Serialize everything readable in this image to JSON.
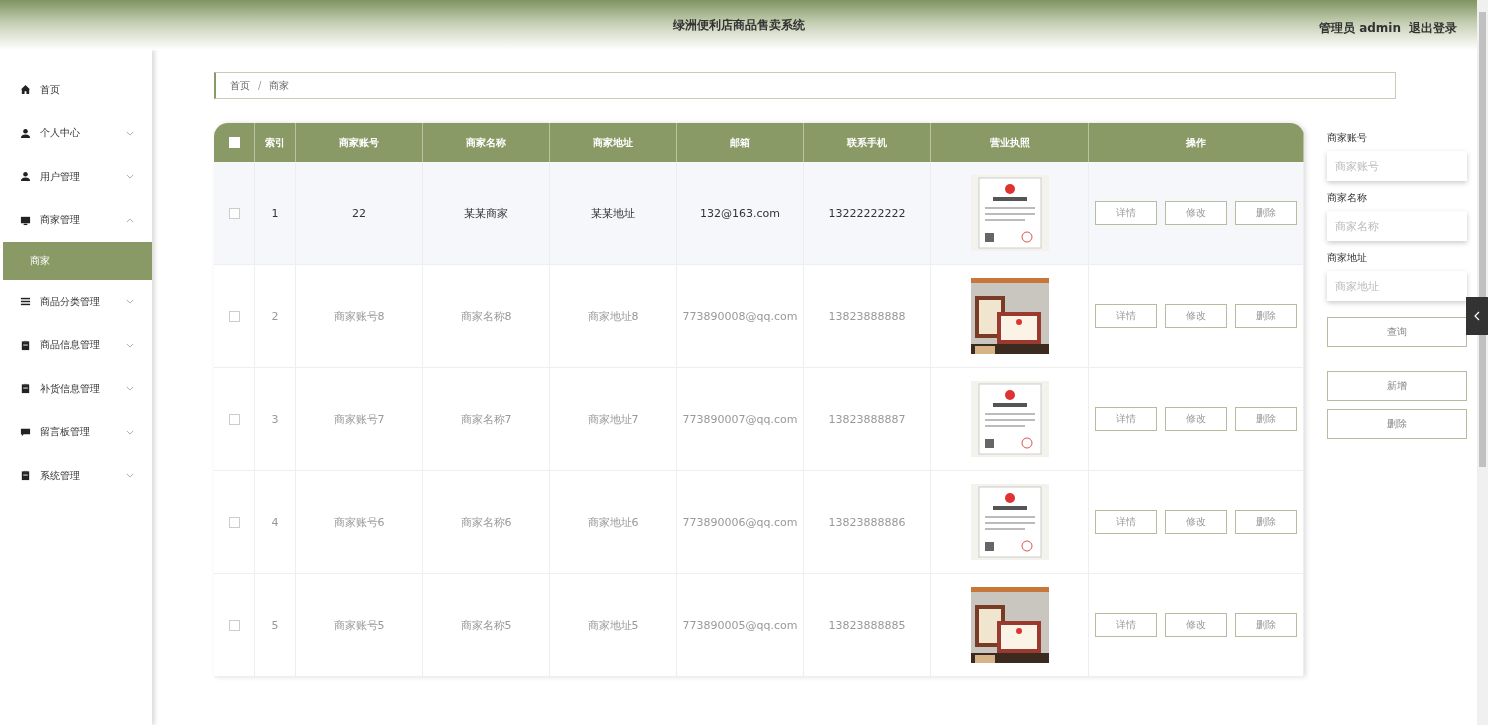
{
  "header": {
    "title": "绿洲便利店商品售卖系统",
    "user": "管理员 admin",
    "logout": "退出登录"
  },
  "sidebar": {
    "items": [
      {
        "label": "首页"
      },
      {
        "label": "个人中心",
        "expanded": false
      },
      {
        "label": "用户管理",
        "expanded": false
      },
      {
        "label": "商家管理",
        "expanded": true,
        "children": [
          {
            "label": "商家",
            "selected": true
          }
        ]
      },
      {
        "label": "商品分类管理",
        "expanded": false
      },
      {
        "label": "商品信息管理",
        "expanded": false
      },
      {
        "label": "补货信息管理",
        "expanded": false
      },
      {
        "label": "留言板管理",
        "expanded": false
      },
      {
        "label": "系统管理",
        "expanded": false
      }
    ]
  },
  "breadcrumb": [
    "首页",
    "商家"
  ],
  "breadcrumb_separator": "/",
  "table": {
    "select_all_checked": false,
    "columns": [
      "索引",
      "商家账号",
      "商家名称",
      "商家地址",
      "邮箱",
      "联系手机",
      "营业执照",
      "操作"
    ],
    "rows": [
      {
        "index": "1",
        "account": "22",
        "name": "某某商家",
        "address": "某某地址",
        "email": "132@163.com",
        "phone": "13222222222",
        "highlighted": true,
        "checked": false,
        "actions": [
          "详情",
          "修改",
          "删除"
        ]
      },
      {
        "index": "2",
        "account": "商家账号8",
        "name": "商家名称8",
        "address": "商家地址8",
        "email": "773890008@qq.com",
        "phone": "13823888888",
        "highlighted": false,
        "checked": false,
        "actions": [
          "详情",
          "修改",
          "删除"
        ]
      },
      {
        "index": "3",
        "account": "商家账号7",
        "name": "商家名称7",
        "address": "商家地址7",
        "email": "773890007@qq.com",
        "phone": "13823888887",
        "highlighted": false,
        "checked": false,
        "actions": [
          "详情",
          "修改",
          "删除"
        ]
      },
      {
        "index": "4",
        "account": "商家账号6",
        "name": "商家名称6",
        "address": "商家地址6",
        "email": "773890006@qq.com",
        "phone": "13823888886",
        "highlighted": false,
        "checked": false,
        "actions": [
          "详情",
          "修改",
          "删除"
        ]
      },
      {
        "index": "5",
        "account": "商家账号5",
        "name": "商家名称5",
        "address": "商家地址5",
        "email": "773890005@qq.com",
        "phone": "13823888885",
        "highlighted": false,
        "checked": false,
        "actions": [
          "详情",
          "修改",
          "删除"
        ]
      }
    ]
  },
  "filters": [
    {
      "label": "商家账号",
      "placeholder": "商家账号"
    },
    {
      "label": "商家名称",
      "placeholder": "商家名称"
    },
    {
      "label": "商家地址",
      "placeholder": "商家地址"
    }
  ],
  "buttons": [
    "查询",
    "新增",
    "删除"
  ]
}
